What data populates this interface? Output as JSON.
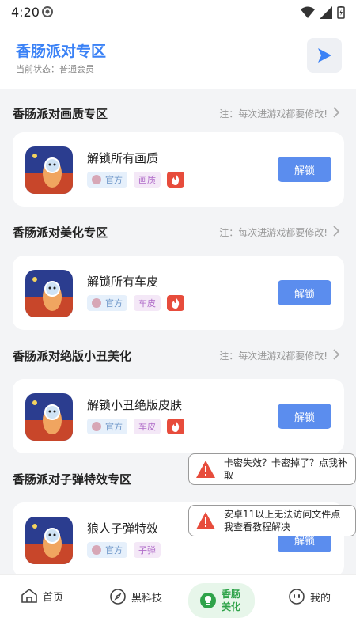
{
  "status_bar": {
    "time": "4:20"
  },
  "header": {
    "title": "香肠派对专区",
    "status": "当前状态：普通会员"
  },
  "sections": [
    {
      "title": "香肠派对画质专区",
      "note": "注：每次进游戏都要修改!",
      "card": {
        "title": "解锁所有画质",
        "tag_official": "官方",
        "tag_category": "画质",
        "button": "解锁"
      }
    },
    {
      "title": "香肠派对美化专区",
      "note": "注：每次进游戏都要修改!",
      "card": {
        "title": "解锁所有车皮",
        "tag_official": "官方",
        "tag_category": "车皮",
        "button": "解锁"
      }
    },
    {
      "title": "香肠派对绝版小丑美化",
      "note": "注：每次进游戏都要修改!",
      "card": {
        "title": "解锁小丑绝版皮肤",
        "tag_official": "官方",
        "tag_category": "车皮",
        "button": "解锁"
      }
    },
    {
      "title": "香肠派对子弹特效专区",
      "note": "",
      "card": {
        "title": "狼人子弹特效",
        "tag_official": "官方",
        "tag_category": "子弹",
        "button": "解锁"
      }
    }
  ],
  "toasts": [
    {
      "text": "卡密失效？卡密掉了？点我补取"
    },
    {
      "text": "安卓11以上无法访问文件点我查看教程解决"
    }
  ],
  "nav": [
    {
      "label": "首页",
      "icon": "home-icon"
    },
    {
      "label": "黑科技",
      "icon": "compass-icon"
    },
    {
      "label": "香肠美化",
      "icon": "bulb-icon"
    },
    {
      "label": "我的",
      "icon": "face-icon"
    }
  ],
  "colors": {
    "accent": "#3b82f6",
    "button": "#5b8dee",
    "hot": "#e74c3c",
    "nav_active": "#2fa34a"
  }
}
